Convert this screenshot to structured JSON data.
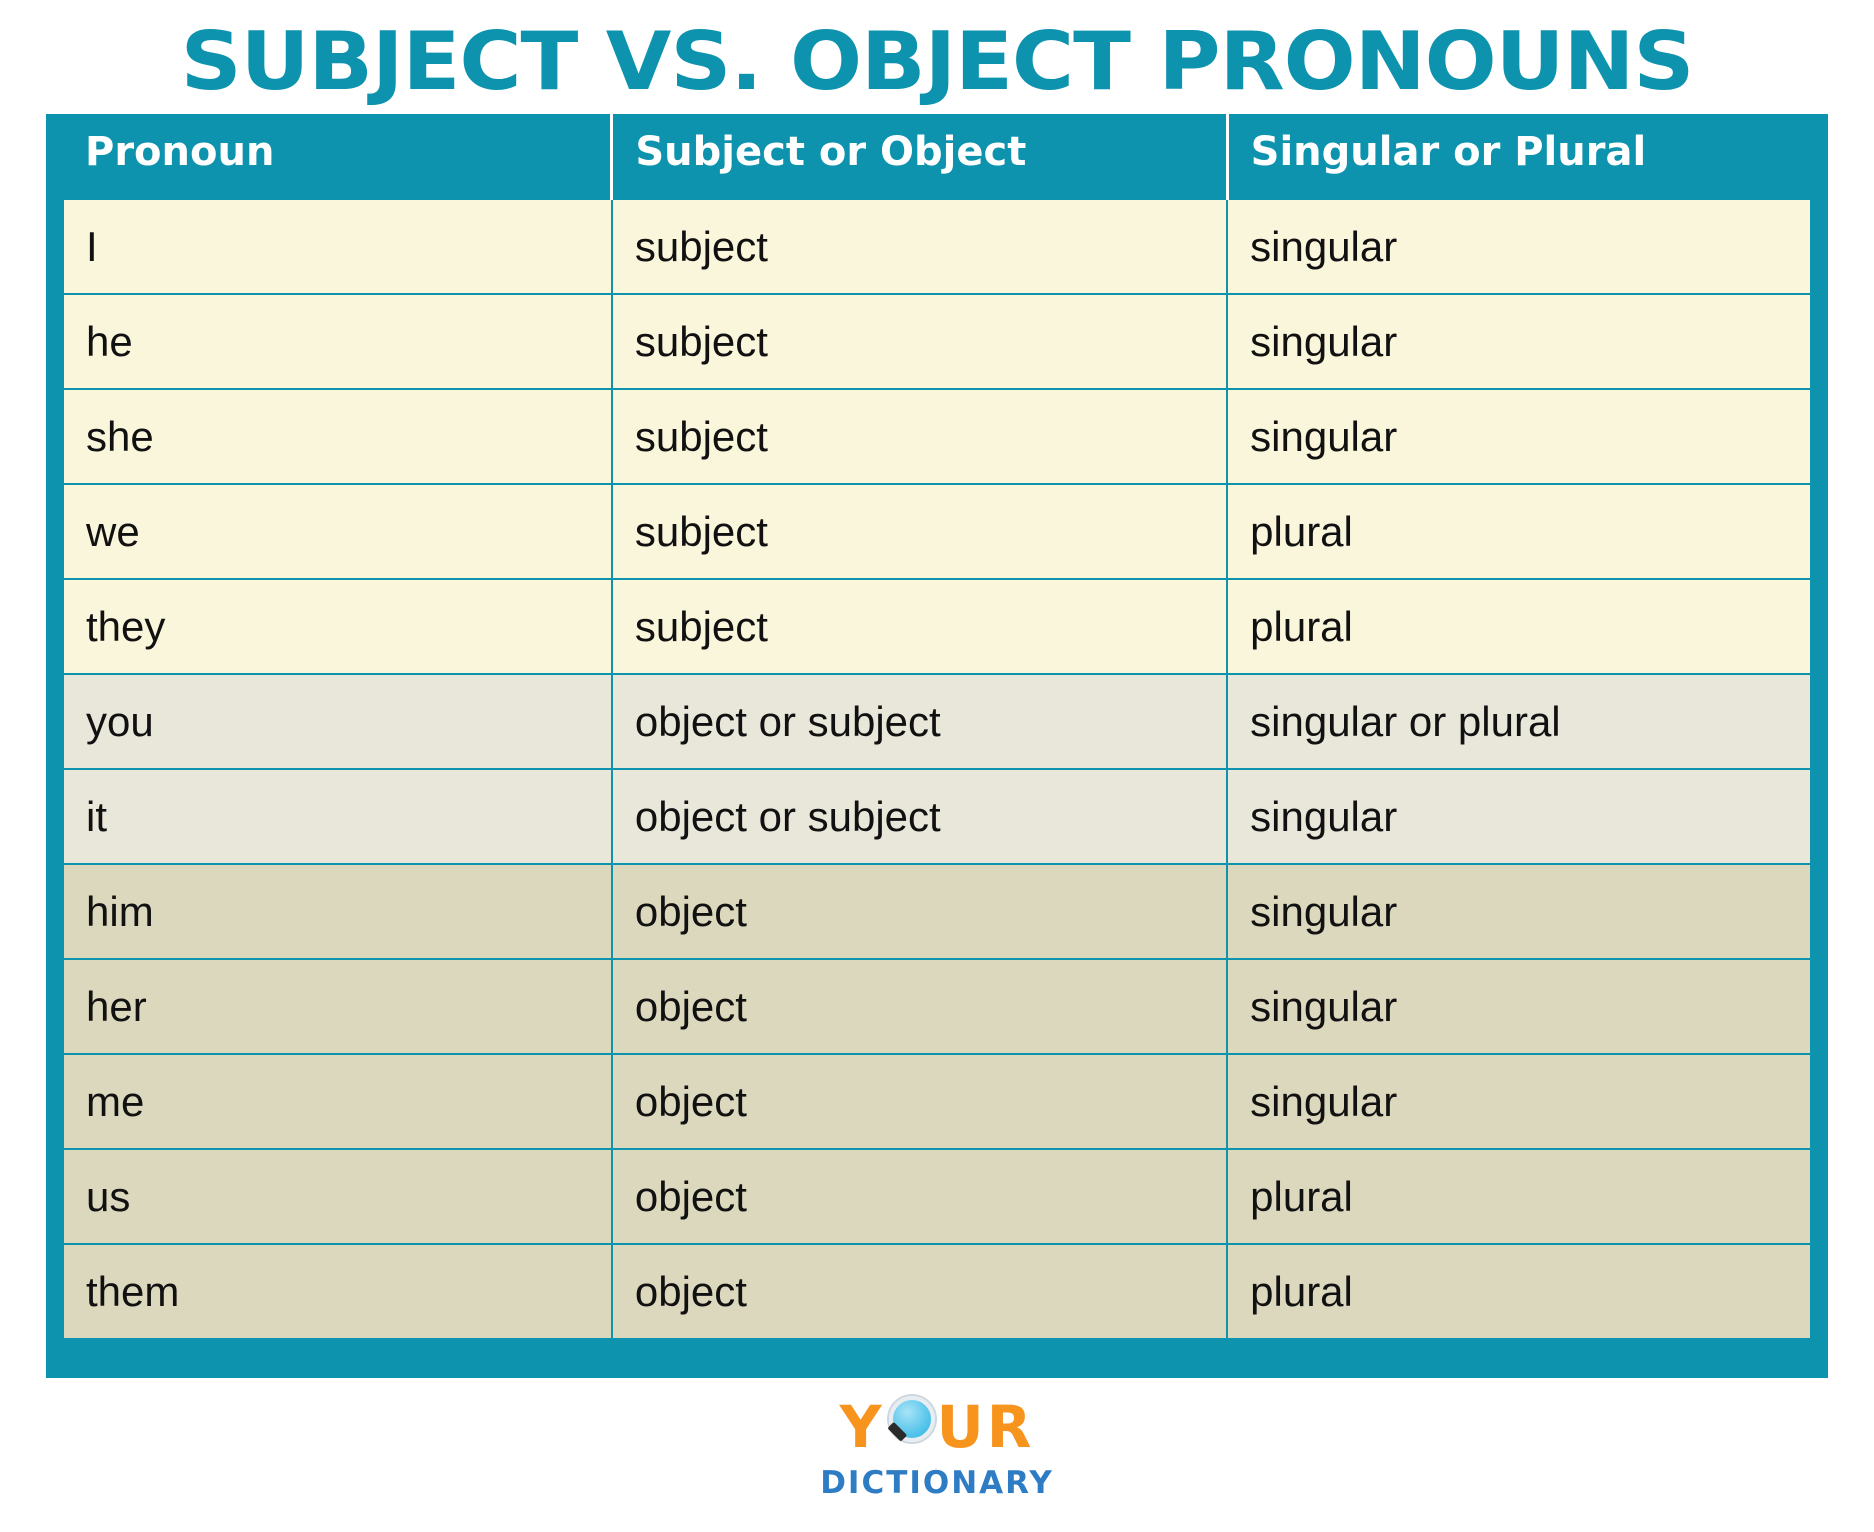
{
  "page": {
    "title": "SUBJECT VS. OBJECT PRONOUNS",
    "accent_color": "#0e93ae",
    "band_colors": [
      "#faf6dc",
      "#e9e7da",
      "#dcd8be"
    ],
    "background": "#ffffff"
  },
  "table": {
    "headers": [
      "Pronoun",
      "Subject or Object",
      "Singular or Plural"
    ],
    "rows": [
      {
        "pronoun": "I",
        "type": "subject",
        "number": "singular",
        "band": "band-a"
      },
      {
        "pronoun": "he",
        "type": "subject",
        "number": "singular",
        "band": "band-a"
      },
      {
        "pronoun": "she",
        "type": "subject",
        "number": "singular",
        "band": "band-a"
      },
      {
        "pronoun": "we",
        "type": "subject",
        "number": "plural",
        "band": "band-a"
      },
      {
        "pronoun": "they",
        "type": "subject",
        "number": "plural",
        "band": "band-a"
      },
      {
        "pronoun": "you",
        "type": "object or subject",
        "number": "singular or plural",
        "band": "band-b"
      },
      {
        "pronoun": "it",
        "type": "object or subject",
        "number": "singular",
        "band": "band-b"
      },
      {
        "pronoun": "him",
        "type": "object",
        "number": "singular",
        "band": "band-c"
      },
      {
        "pronoun": "her",
        "type": "object",
        "number": "singular",
        "band": "band-c"
      },
      {
        "pronoun": "me",
        "type": "object",
        "number": "singular",
        "band": "band-c"
      },
      {
        "pronoun": "us",
        "type": "object",
        "number": "plural",
        "band": "band-c"
      },
      {
        "pronoun": "them",
        "type": "object",
        "number": "plural",
        "band": "band-c"
      }
    ]
  },
  "logo": {
    "word_start": "Y",
    "word_end": "UR",
    "subtitle": "DICTIONARY",
    "word_color": "#f7941e",
    "subtitle_color": "#2e7dc4",
    "icon": "magnifying-glass-icon"
  }
}
